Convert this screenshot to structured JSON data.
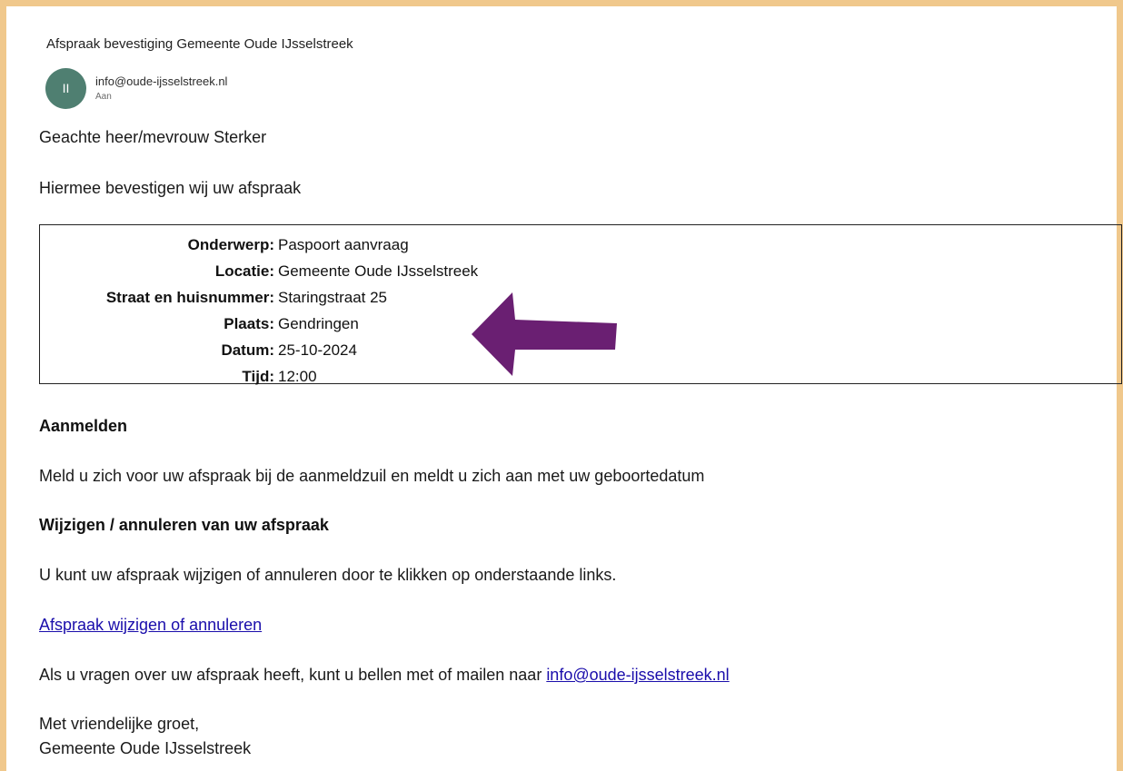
{
  "email": {
    "subject": "Afspraak bevestiging Gemeente Oude IJsselstreek",
    "avatar_initials": "II",
    "sender": "info@oude-ijsselstreek.nl",
    "recipient_label": "Aan",
    "greeting": "Geachte heer/mevrouw Sterker",
    "intro": "Hiermee bevestigen wij uw afspraak",
    "details": [
      {
        "label": "Onderwerp:",
        "value": "Paspoort aanvraag"
      },
      {
        "label": "Locatie:",
        "value": "Gemeente Oude IJsselstreek"
      },
      {
        "label": "Straat en huisnummer:",
        "value": "Staringstraat 25"
      },
      {
        "label": "Plaats:",
        "value": "Gendringen"
      },
      {
        "label": "Datum:",
        "value": "25-10-2024"
      },
      {
        "label": "Tijd:",
        "value": "12:00"
      }
    ],
    "checkin_heading": "Aanmelden",
    "checkin_text": "Meld u zich voor uw afspraak bij de aanmeldzuil en meldt u zich aan met uw geboortedatum",
    "change_heading": "Wijzigen / annuleren van uw afspraak",
    "change_text": "U kunt uw afspraak wijzigen of annuleren door te klikken op onderstaande links.",
    "change_link": "Afspraak wijzigen of annuleren",
    "questions_text": "Als u vragen over uw afspraak heeft, kunt u bellen met of mailen naar ",
    "questions_link": "info@oude-ijsselstreek.nl",
    "closing": "Met vriendelijke groet,",
    "signature": "Gemeente Oude IJsselstreek"
  },
  "icons": {
    "annotation_arrow": "left-arrow-icon"
  },
  "colors": {
    "frame_border": "#f0c88c",
    "avatar_bg": "#4f7f71",
    "arrow": "#6a1f72",
    "link": "#1a0dab"
  }
}
